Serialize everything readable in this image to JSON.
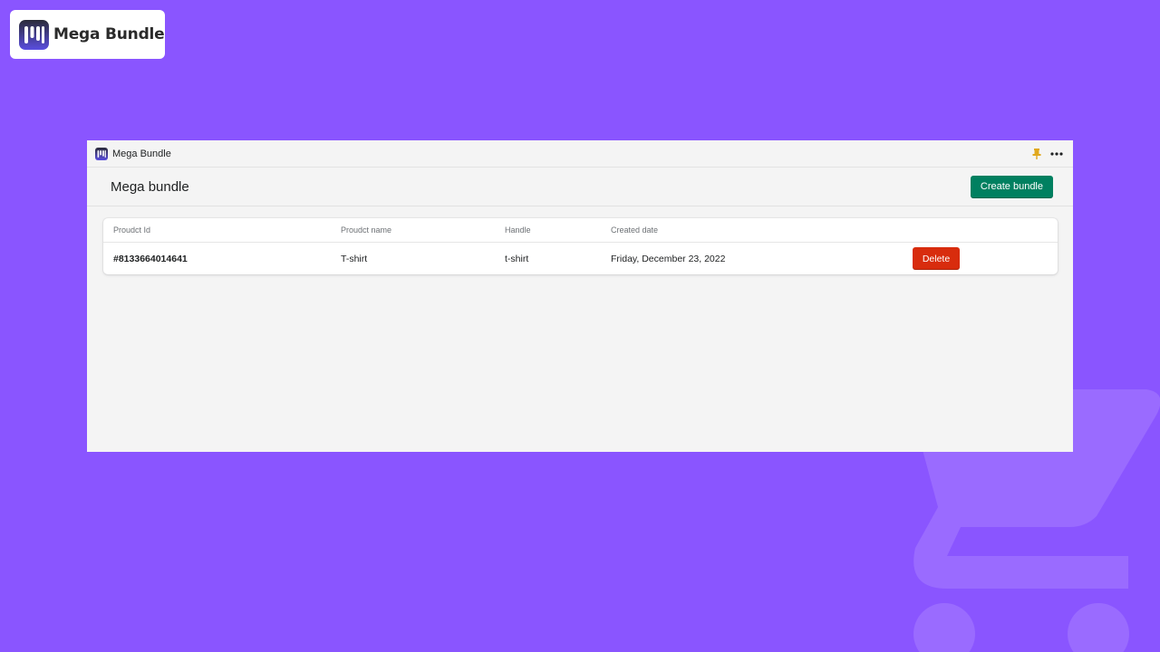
{
  "brand": {
    "name": "Mega Bundle",
    "logo_icon": "mega-bundle-logo-icon"
  },
  "app": {
    "titlebar": {
      "app_name": "Mega Bundle",
      "pin_icon": "pin-icon",
      "more_icon": "more-actions-icon"
    },
    "page": {
      "title": "Mega bundle",
      "create_button": "Create bundle"
    },
    "table": {
      "headers": {
        "id": "Proudct Id",
        "name": "Proudct name",
        "handle": "Handle",
        "created": "Created date"
      },
      "rows": [
        {
          "id": "#8133664014641",
          "name": "T-shirt",
          "handle": "t-shirt",
          "created": "Friday, December 23, 2022",
          "action": "Delete"
        }
      ]
    }
  },
  "colors": {
    "background": "#8a55ff",
    "primary_button": "#008060",
    "delete_button": "#d82c0d",
    "pin": "#e0a81e"
  }
}
